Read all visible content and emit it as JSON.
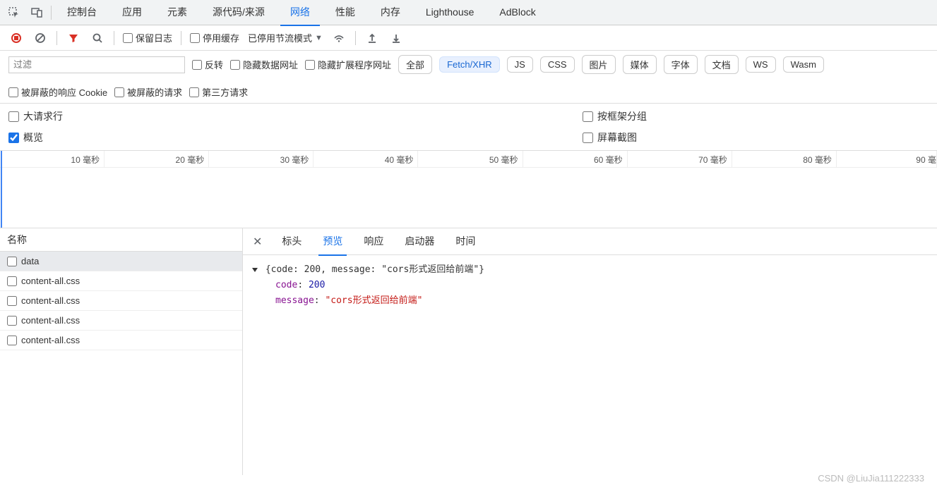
{
  "main_tabs": [
    "控制台",
    "应用",
    "元素",
    "源代码/来源",
    "网络",
    "性能",
    "内存",
    "Lighthouse",
    "AdBlock"
  ],
  "main_active": "网络",
  "toolbar": {
    "preserve_log": "保留日志",
    "disable_cache": "停用缓存",
    "throttling": "已停用节流模式"
  },
  "filter": {
    "placeholder": "过滤",
    "invert": "反转",
    "hide_data": "隐藏数据网址",
    "hide_ext": "隐藏扩展程序网址",
    "types": [
      "全部",
      "Fetch/XHR",
      "JS",
      "CSS",
      "图片",
      "媒体",
      "字体",
      "文档",
      "WS",
      "Wasm"
    ],
    "type_selected": "Fetch/XHR",
    "blocked_cookies": "被屏蔽的响应 Cookie",
    "blocked_requests": "被屏蔽的请求",
    "third_party": "第三方请求"
  },
  "options": {
    "large_rows": "大请求行",
    "overview": "概览",
    "group_by_frame": "按框架分组",
    "screenshots": "屏幕截图"
  },
  "timeline_ticks": [
    "10 毫秒",
    "20 毫秒",
    "30 毫秒",
    "40 毫秒",
    "50 毫秒",
    "60 毫秒",
    "70 毫秒",
    "80 毫秒",
    "90 毫"
  ],
  "requests": {
    "header": "名称",
    "items": [
      "data",
      "content-all.css",
      "content-all.css",
      "content-all.css",
      "content-all.css"
    ],
    "selected": 0
  },
  "detail_tabs": [
    "标头",
    "预览",
    "响应",
    "启动器",
    "时间"
  ],
  "detail_active": "预览",
  "preview": {
    "summary": "{code: 200, message: \"cors形式返回给前端\"}",
    "code_key": "code",
    "code_val": "200",
    "msg_key": "message",
    "msg_val": "\"cors形式返回给前端\""
  },
  "watermark": "CSDN @LiuJia111222333"
}
